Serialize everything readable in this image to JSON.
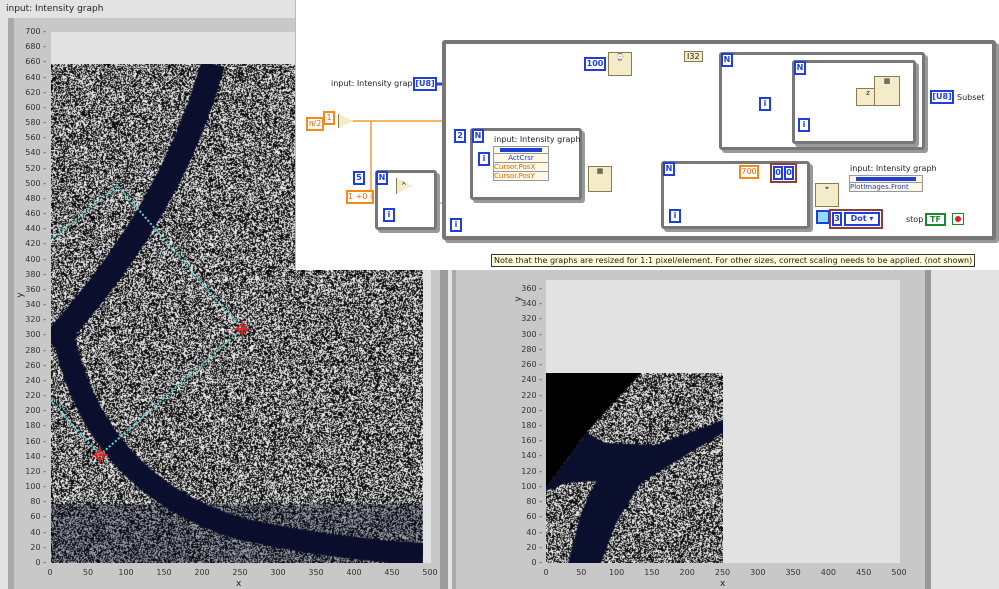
{
  "left_graph": {
    "label": "input: Intensity graph",
    "x_axis_label": "x",
    "y_axis_label": "y",
    "x_ticks": [
      "0",
      "50",
      "100",
      "150",
      "200",
      "250",
      "300",
      "350",
      "400",
      "450",
      "500"
    ],
    "y_ticks": [
      "0",
      "20",
      "40",
      "60",
      "80",
      "100",
      "120",
      "140",
      "160",
      "180",
      "200",
      "220",
      "240",
      "260",
      "280",
      "300",
      "320",
      "340",
      "360",
      "380",
      "400",
      "420",
      "440",
      "460",
      "480",
      "500",
      "520",
      "540",
      "560",
      "580",
      "600",
      "620",
      "640",
      "660",
      "680",
      "700"
    ],
    "x_range": [
      0,
      500
    ],
    "y_range": [
      0,
      700
    ],
    "image_extent": {
      "x": [
        0,
        490
      ],
      "y": [
        0,
        660
      ]
    }
  },
  "right_graph": {
    "x_axis_label": "x",
    "y_axis_label": "y",
    "x_ticks": [
      "0",
      "50",
      "100",
      "150",
      "200",
      "250",
      "300",
      "350",
      "400",
      "450",
      "500"
    ],
    "y_ticks": [
      "0",
      "20",
      "40",
      "60",
      "80",
      "100",
      "120",
      "140",
      "160",
      "180",
      "200",
      "220",
      "240",
      "260",
      "280",
      "300",
      "320",
      "340",
      "360"
    ],
    "x_range": [
      0,
      500
    ],
    "y_range": [
      0,
      360
    ],
    "image_extent": {
      "x": [
        0,
        250
      ],
      "y": [
        0,
        250
      ]
    }
  },
  "diagram": {
    "input_label": "input: Intensity graph",
    "u8": "[U8]",
    "pi2": "π/2",
    "one": "1",
    "complex_const": "1 +0 i",
    "n5": "5",
    "n2": "2",
    "N": "N",
    "i": "i",
    "wait_ms": "100",
    "i32": "I32",
    "c700": "700",
    "c00a": "0",
    "c00b": "0",
    "prop_label": "input: Intensity graph",
    "prop_items": [
      "ActCrsr",
      "Cursor.PosX",
      "Cursor.PosY"
    ],
    "plot_label": "input: Intensity graph",
    "plot_item": "PlotImages.Front",
    "dot_num": "3",
    "dot_style": "Dot ▾",
    "subset_label": "Subset",
    "stop_label": "stop",
    "tf": "TF",
    "note": "Note that the graphs are resized for 1:1 pixel/element. For other sizes, correct scaling needs to be applied. (not shown)"
  },
  "colors": {
    "navy_band": "#0b0f2e",
    "cursor": "#e02020",
    "cursor_line": "#5fd6d6",
    "wire_blue": "#2b3fe0",
    "wire_orange": "#f39a3b"
  }
}
